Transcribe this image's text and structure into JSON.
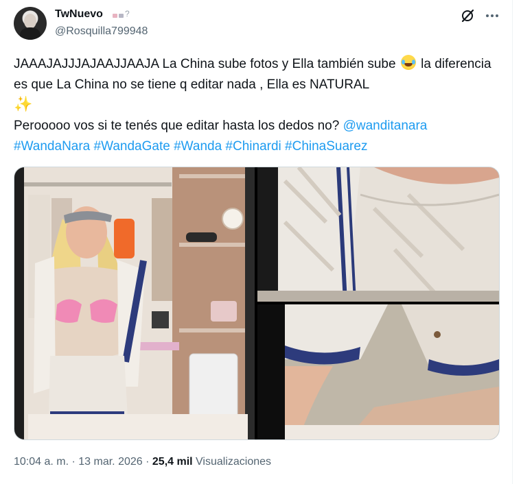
{
  "author": {
    "display_name": "TwNuevo",
    "handle": "@Rosquilla799948",
    "avatar_icon": "avatar-photo",
    "name_badge_icon": "emoji-icons"
  },
  "header_actions": {
    "grok_icon": "grok-slash-circle-icon",
    "more_icon": "more-dots-icon"
  },
  "tweet": {
    "line1_a": "JAAAJAJJJAJAAJJAAJA La China sube fotos y Ella también sube",
    "line1_b": "la diferencia es que La China no se tiene q editar nada , Ella es NATURAL",
    "line2_text": "Perooooo vos si te tenés que editar hasta los dedos no?",
    "mention": "@wanditanara",
    "hashtags": [
      "#WandaNara",
      "#WandaGate",
      "#Wanda",
      "#Chinardi",
      "#ChinaSuarez"
    ]
  },
  "media": {
    "images": [
      "photo-left",
      "photo-right-top",
      "photo-right-bottom"
    ]
  },
  "meta": {
    "time": "10:04 a. m.",
    "sep1": " · ",
    "date": "13 mar. 2026",
    "sep2": " · ",
    "views_count": "25,4 mil",
    "views_label": "Visualizaciones"
  },
  "colors": {
    "link": "#1d9bf0",
    "text": "#0f1419",
    "secondary": "#536471",
    "border": "#cfd9de"
  }
}
